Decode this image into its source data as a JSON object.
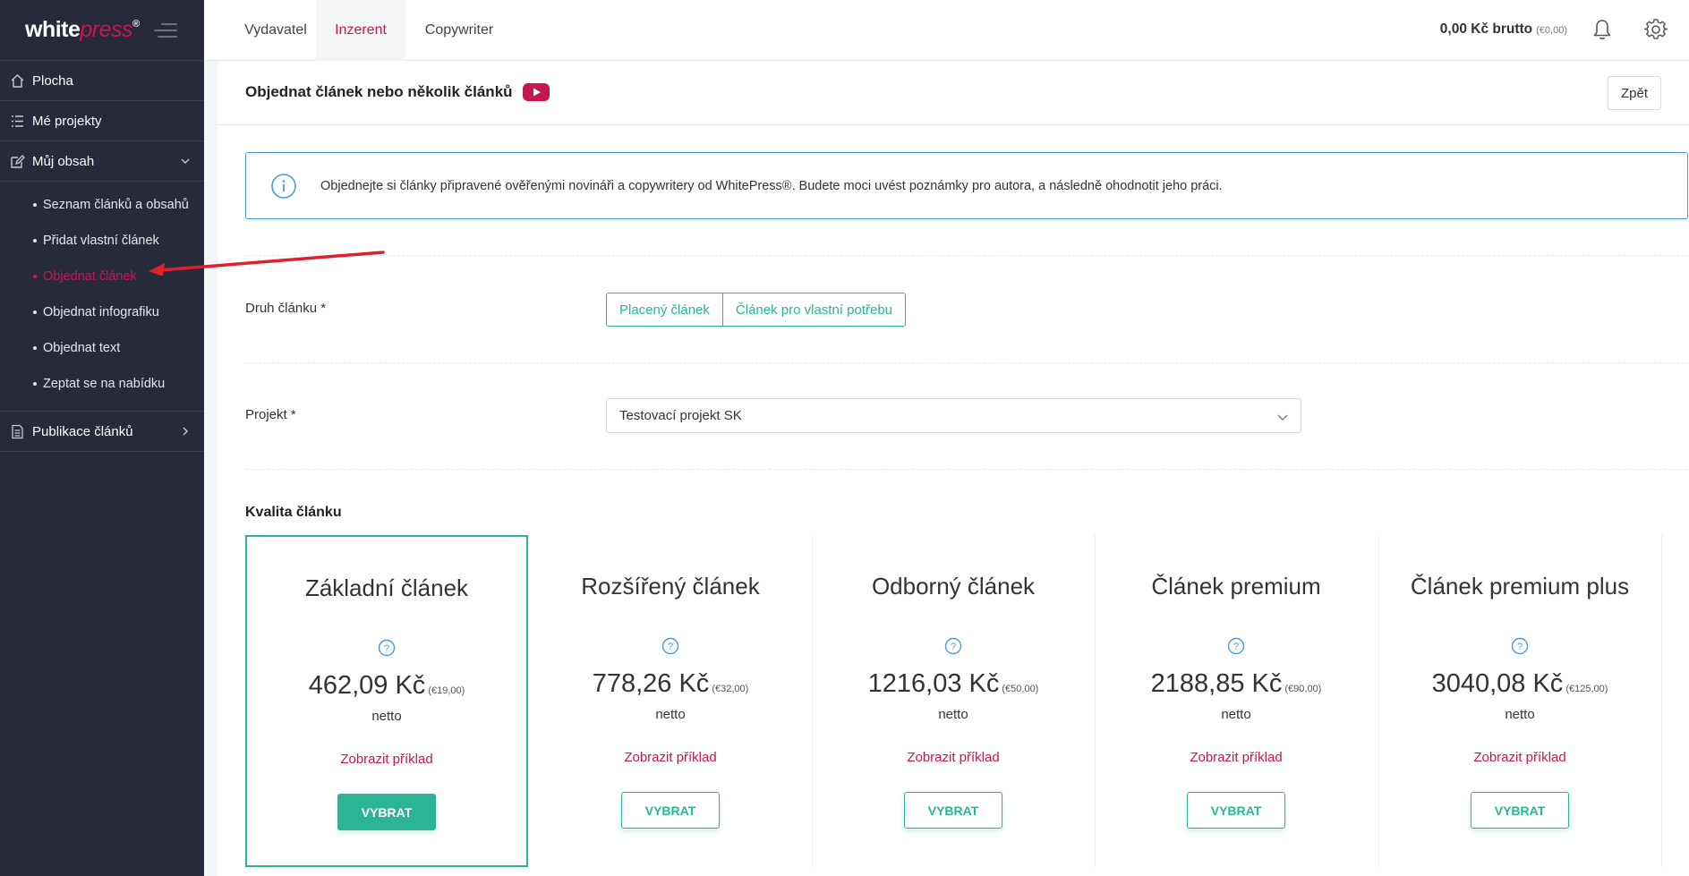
{
  "brand": {
    "name_white": "white",
    "name_press": "press",
    "registered": "®"
  },
  "sidebar": {
    "items": [
      {
        "label": "Plocha",
        "icon": "home-icon"
      },
      {
        "label": "Mé projekty",
        "icon": "list-icon"
      },
      {
        "label": "Můj obsah",
        "icon": "edit-icon",
        "expanded": true
      },
      {
        "label": "Publikace článků",
        "icon": "document-icon"
      }
    ],
    "subitems": [
      {
        "label": "Seznam článků a obsahů"
      },
      {
        "label": "Přidat vlastní článek"
      },
      {
        "label": "Objednat článek",
        "active": true
      },
      {
        "label": "Objednat infografiku"
      },
      {
        "label": "Objednat text"
      },
      {
        "label": "Zeptat se na nabídku"
      }
    ]
  },
  "topbar": {
    "tabs": [
      {
        "label": "Vydavatel"
      },
      {
        "label": "Inzerent",
        "active": true
      },
      {
        "label": "Copywriter"
      }
    ],
    "balance": "0,00 Kč brutto",
    "balance_eur": "(€0,00)"
  },
  "page": {
    "title": "Objednat článek nebo několik článků",
    "back_label": "Zpět",
    "info_text": "Objednejte si články připravené ověřenými novináři a copywritery od WhitePress®. Budete moci uvést poznámky pro autora, a následně ohodnotit jeho práci."
  },
  "form": {
    "article_type_label": "Druh článku *",
    "article_type_options": [
      "Placený článek",
      "Článek pro vlastní potřebu"
    ],
    "project_label": "Projekt *",
    "project_value": "Testovací projekt SK",
    "quality_label": "Kvalita článku"
  },
  "cards": [
    {
      "title": "Základní článek",
      "price": "462,09 Kč",
      "price_eur": "(€19,00)",
      "netto": "netto",
      "example": "Zobrazit příklad",
      "button": "VYBRAT",
      "selected": true
    },
    {
      "title": "Rozšířený článek",
      "price": "778,26 Kč",
      "price_eur": "(€32,00)",
      "netto": "netto",
      "example": "Zobrazit příklad",
      "button": "VYBRAT"
    },
    {
      "title": "Odborný článek",
      "price": "1216,03 Kč",
      "price_eur": "(€50,00)",
      "netto": "netto",
      "example": "Zobrazit příklad",
      "button": "VYBRAT"
    },
    {
      "title": "Článek premium",
      "price": "2188,85 Kč",
      "price_eur": "(€90,00)",
      "netto": "netto",
      "example": "Zobrazit příklad",
      "button": "VYBRAT"
    },
    {
      "title": "Článek premium plus",
      "price": "3040,08 Kč",
      "price_eur": "(€125,00)",
      "netto": "netto",
      "example": "Zobrazit příklad",
      "button": "VYBRAT"
    }
  ],
  "colors": {
    "accent": "#c8174e",
    "primary": "#2bb596",
    "info": "#4a9bd9",
    "sidebar": "#272a3a"
  }
}
